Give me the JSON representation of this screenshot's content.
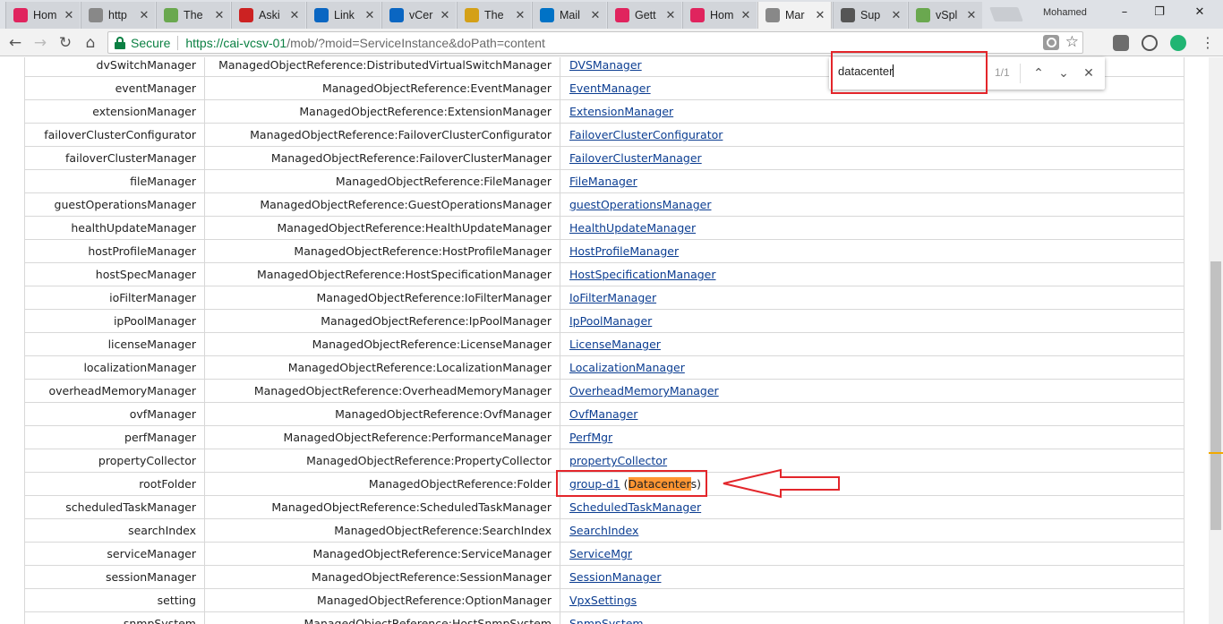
{
  "browser": {
    "tabs": [
      {
        "title": "Hom",
        "icon": "media-icon",
        "color": "#e0245e"
      },
      {
        "title": "http",
        "icon": "page-icon",
        "color": "#888888"
      },
      {
        "title": "The",
        "icon": "site-icon",
        "color": "#6aa84f"
      },
      {
        "title": "Aski",
        "icon": "askme-icon",
        "color": "#cc2222"
      },
      {
        "title": "Link",
        "icon": "linkedin-icon",
        "color": "#0a66c2"
      },
      {
        "title": "vCer",
        "icon": "linkedin-icon",
        "color": "#0a66c2"
      },
      {
        "title": "The",
        "icon": "site-icon",
        "color": "#d4a017"
      },
      {
        "title": "Mail",
        "icon": "outlook-icon",
        "color": "#0072c6"
      },
      {
        "title": "Gett",
        "icon": "media-icon",
        "color": "#e0245e"
      },
      {
        "title": "Hom",
        "icon": "media-icon",
        "color": "#e0245e"
      },
      {
        "title": "Mar",
        "icon": "page-icon",
        "color": "#888888"
      },
      {
        "title": "Sup",
        "icon": "vmware-icon",
        "color": "#555555"
      },
      {
        "title": "vSpl",
        "icon": "vsphere-icon",
        "color": "#6aa84f"
      }
    ],
    "active_tab": 10,
    "profile_name": "Mohamed",
    "secure_label": "Secure",
    "url_host": "https://cai-vcsv-01",
    "url_rest": "/mob/?moid=ServiceInstance&doPath=content"
  },
  "find_bar": {
    "query": "datacenter",
    "count": "1/1"
  },
  "table": {
    "rows": [
      {
        "name": "dvSwitchManager",
        "type": "ManagedObjectReference:DistributedVirtualSwitchManager",
        "value": "DVSManager"
      },
      {
        "name": "eventManager",
        "type": "ManagedObjectReference:EventManager",
        "value": "EventManager"
      },
      {
        "name": "extensionManager",
        "type": "ManagedObjectReference:ExtensionManager",
        "value": "ExtensionManager"
      },
      {
        "name": "failoverClusterConfigurator",
        "type": "ManagedObjectReference:FailoverClusterConfigurator",
        "value": "FailoverClusterConfigurator"
      },
      {
        "name": "failoverClusterManager",
        "type": "ManagedObjectReference:FailoverClusterManager",
        "value": "FailoverClusterManager"
      },
      {
        "name": "fileManager",
        "type": "ManagedObjectReference:FileManager",
        "value": "FileManager"
      },
      {
        "name": "guestOperationsManager",
        "type": "ManagedObjectReference:GuestOperationsManager",
        "value": "guestOperationsManager"
      },
      {
        "name": "healthUpdateManager",
        "type": "ManagedObjectReference:HealthUpdateManager",
        "value": "HealthUpdateManager"
      },
      {
        "name": "hostProfileManager",
        "type": "ManagedObjectReference:HostProfileManager",
        "value": "HostProfileManager"
      },
      {
        "name": "hostSpecManager",
        "type": "ManagedObjectReference:HostSpecificationManager",
        "value": "HostSpecificationManager"
      },
      {
        "name": "ioFilterManager",
        "type": "ManagedObjectReference:IoFilterManager",
        "value": "IoFilterManager"
      },
      {
        "name": "ipPoolManager",
        "type": "ManagedObjectReference:IpPoolManager",
        "value": "IpPoolManager"
      },
      {
        "name": "licenseManager",
        "type": "ManagedObjectReference:LicenseManager",
        "value": "LicenseManager"
      },
      {
        "name": "localizationManager",
        "type": "ManagedObjectReference:LocalizationManager",
        "value": "LocalizationManager"
      },
      {
        "name": "overheadMemoryManager",
        "type": "ManagedObjectReference:OverheadMemoryManager",
        "value": "OverheadMemoryManager"
      },
      {
        "name": "ovfManager",
        "type": "ManagedObjectReference:OvfManager",
        "value": "OvfManager"
      },
      {
        "name": "perfManager",
        "type": "ManagedObjectReference:PerformanceManager",
        "value": "PerfMgr"
      },
      {
        "name": "propertyCollector",
        "type": "ManagedObjectReference:PropertyCollector",
        "value": "propertyCollector"
      },
      {
        "name": "rootFolder",
        "type": "ManagedObjectReference:Folder",
        "value": "group-d1",
        "extra_open": " (",
        "extra_highlight": "Datacenter",
        "extra_close": "s)"
      },
      {
        "name": "scheduledTaskManager",
        "type": "ManagedObjectReference:ScheduledTaskManager",
        "value": "ScheduledTaskManager"
      },
      {
        "name": "searchIndex",
        "type": "ManagedObjectReference:SearchIndex",
        "value": "SearchIndex"
      },
      {
        "name": "serviceManager",
        "type": "ManagedObjectReference:ServiceManager",
        "value": "ServiceMgr"
      },
      {
        "name": "sessionManager",
        "type": "ManagedObjectReference:SessionManager",
        "value": "SessionManager"
      },
      {
        "name": "setting",
        "type": "ManagedObjectReference:OptionManager",
        "value": "VpxSettings"
      },
      {
        "name": "snmpSystem",
        "type": "ManagedObjectReference:HostSnmpSystem",
        "value": "SnmpSystem"
      }
    ]
  },
  "colors": {
    "highlight": "#ff9632",
    "annotation_red": "#e3262b",
    "link": "#0b3d91",
    "secure_green": "#0b8043"
  }
}
